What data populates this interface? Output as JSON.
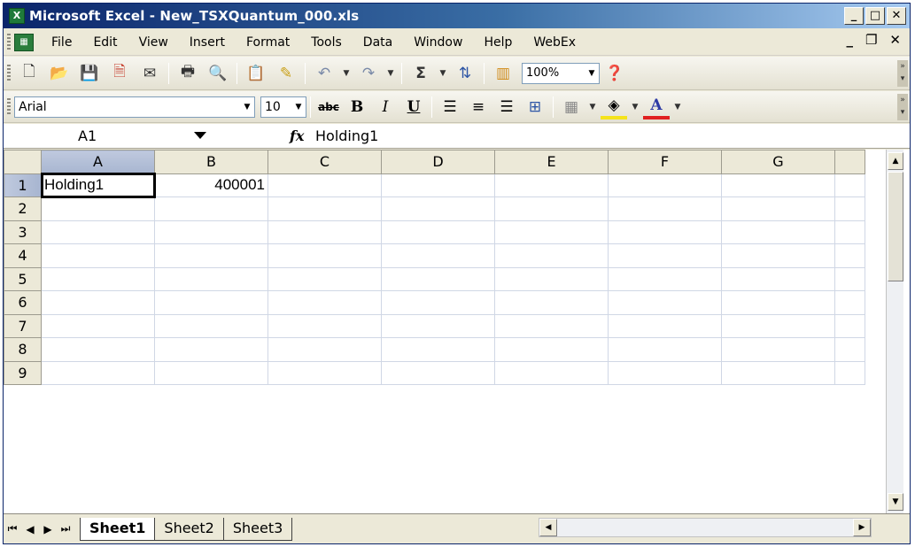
{
  "window": {
    "title": "Microsoft Excel - New_TSXQuantum_000.xls",
    "min_label": "_",
    "max_label": "□",
    "close_label": "✕"
  },
  "menu": {
    "items": [
      "File",
      "Edit",
      "View",
      "Insert",
      "Format",
      "Tools",
      "Data",
      "Window",
      "Help",
      "WebEx"
    ],
    "doc_min": "_",
    "doc_restore": "❐",
    "doc_close": "✕"
  },
  "standard_toolbar": {
    "zoom": "100%",
    "sigma": "Σ"
  },
  "formatting_toolbar": {
    "font_name": "Arial",
    "font_size": "10",
    "bold_label": "B",
    "italic_label": "I",
    "underline_label": "U",
    "strike_label": "abc"
  },
  "formula_bar": {
    "name_box": "A1",
    "fx": "fx",
    "value": "Holding1"
  },
  "sheet": {
    "columns": [
      "A",
      "B",
      "C",
      "D",
      "E",
      "F",
      "G"
    ],
    "rows": [
      "1",
      "2",
      "3",
      "4",
      "5",
      "6",
      "7",
      "8",
      "9"
    ],
    "cells": {
      "A1": "Holding1",
      "B1": "400001"
    },
    "selected_cell": "A1"
  },
  "tabs": {
    "sheets": [
      "Sheet1",
      "Sheet2",
      "Sheet3"
    ],
    "active": "Sheet1"
  },
  "colors": {
    "title_gradient_start": "#0a246a",
    "chrome": "#ece9d8"
  }
}
